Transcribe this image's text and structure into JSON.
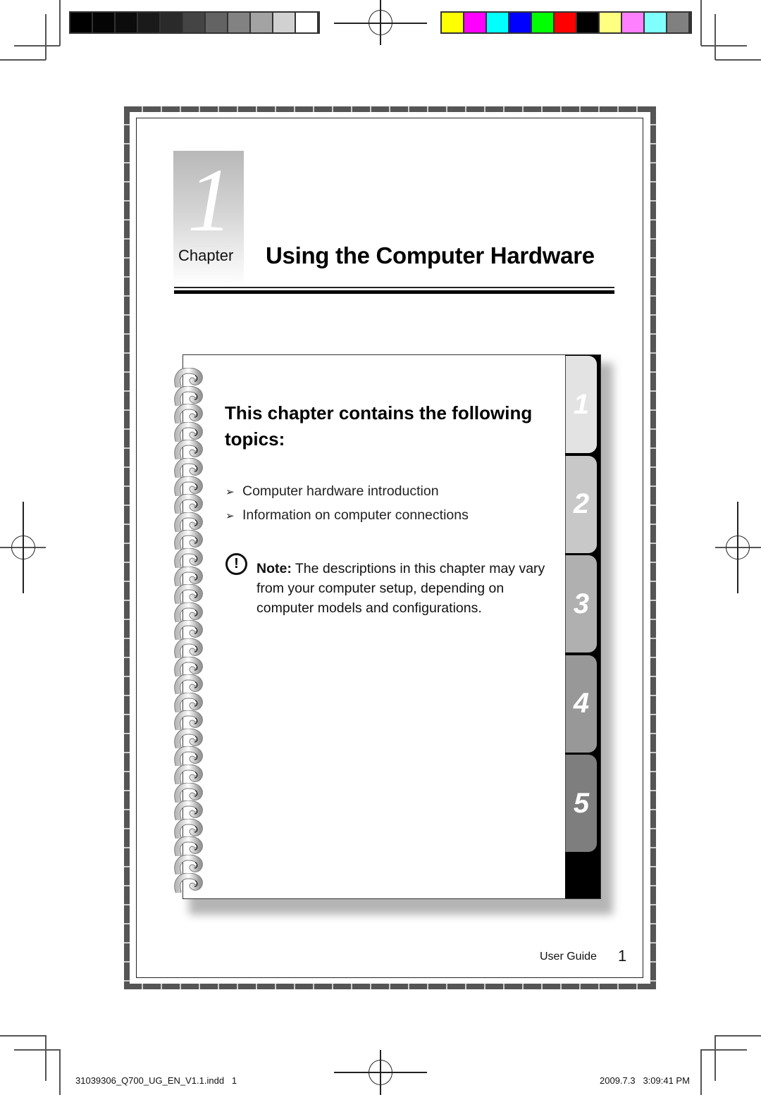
{
  "print_marks": {
    "grayscale_bar": [
      "#000000",
      "#050505",
      "#0c0c0c",
      "#1a1a1a",
      "#2a2a2a",
      "#444444",
      "#636363",
      "#828282",
      "#a3a3a3",
      "#d1d1d1",
      "#ffffff"
    ],
    "color_bar": [
      "#ffff00",
      "#ff00ff",
      "#00ffff",
      "#0000ff",
      "#00ff00",
      "#ff0000",
      "#000000",
      "#ffff80",
      "#ff80ff",
      "#80ffff",
      "#808080"
    ]
  },
  "chapter": {
    "number": "1",
    "word": "Chapter",
    "title": "Using the Computer Hardware"
  },
  "notebook": {
    "heading": "This chapter contains the following topics:",
    "topics": [
      "Computer hardware introduction",
      "Information on computer connections"
    ],
    "bullet_glyph": "➢",
    "note_icon": "!",
    "note_label": "Note:",
    "note_text": " The descriptions in this chapter may vary from your computer setup, depending on computer models and configurations.",
    "tabs": [
      {
        "label": "1",
        "color": "#e3e3e3"
      },
      {
        "label": "2",
        "color": "#c8c8c8"
      },
      {
        "label": "3",
        "color": "#b0b0b0"
      },
      {
        "label": "4",
        "color": "#989898"
      },
      {
        "label": "5",
        "color": "#7e7e7e"
      }
    ]
  },
  "footer": {
    "label": "User Guide",
    "page": "1"
  },
  "slug": {
    "file": "31039306_Q700_UG_EN_V1.1.indd   1",
    "timestamp": "2009.7.3   3:09:41 PM"
  }
}
